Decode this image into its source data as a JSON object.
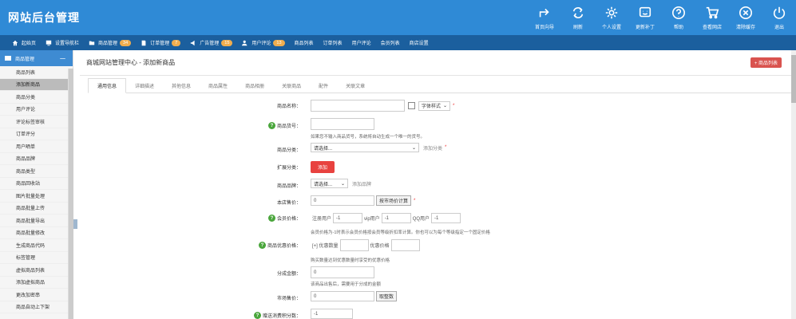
{
  "app": {
    "title": "网站后台管理"
  },
  "tools": [
    {
      "icon": "share-icon",
      "label": "首页向导"
    },
    {
      "icon": "refresh-icon",
      "label": "刷新"
    },
    {
      "icon": "gear-icon",
      "label": "个人设置"
    },
    {
      "icon": "update-icon",
      "label": "更新补丁"
    },
    {
      "icon": "help-icon",
      "label": "帮助"
    },
    {
      "icon": "cart-icon",
      "label": "查看网店"
    },
    {
      "icon": "clear-icon",
      "label": "清除缓存"
    },
    {
      "icon": "power-icon",
      "label": "退出"
    }
  ],
  "nav": [
    {
      "label": "起始页",
      "badge": ""
    },
    {
      "label": "设置导航栏",
      "badge": ""
    },
    {
      "label": "商品管理",
      "badge": "34"
    },
    {
      "label": "订单管理",
      "badge": "7"
    },
    {
      "label": "广告管理",
      "badge": "15"
    },
    {
      "label": "用户评论",
      "badge": "13"
    },
    {
      "label": "商品列表",
      "badge": ""
    },
    {
      "label": "订单列表",
      "badge": ""
    },
    {
      "label": "用户评论",
      "badge": ""
    },
    {
      "label": "会员列表",
      "badge": ""
    },
    {
      "label": "商店设置",
      "badge": ""
    }
  ],
  "sidebar": {
    "head": "商品管理",
    "minus": "－",
    "items": [
      "商品列表",
      "添加新商品",
      "商品分类",
      "用户评论",
      "评论标签审核",
      "订单评分",
      "用户晒单",
      "商品品牌",
      "商品类型",
      "商品回收站",
      "图片批量处理",
      "商品批量上传",
      "商品批量导出",
      "商品批量修改",
      "生成商品代码",
      "标签管理",
      "虚拟商品列表",
      "添加虚拟商品",
      "更改加密串",
      "商品自动上下架"
    ],
    "active": 1
  },
  "main": {
    "breadcrumb": "商城网站管理中心 - 添加新商品",
    "list_button": "+ 商品列表",
    "tabs": [
      "通用信息",
      "详细描述",
      "其他信息",
      "商品属性",
      "商品相册",
      "关联商品",
      "配件",
      "关联文章"
    ]
  },
  "form": {
    "name_label": "商品名称：",
    "font_style": "字体样式",
    "required": "*",
    "sn_label": "商品货号：",
    "sn_hint": "如果您不输入商品货号，系统将自动生成一个唯一的货号。",
    "cat_label": "商品分类：",
    "select_please": "请选择...",
    "add_cat": "添加分类",
    "ext_label": "扩展分类：",
    "add_btn": "添加",
    "brand_label": "商品品牌：",
    "add_brand": "添加品牌",
    "price_label": "本店售价：",
    "price_value": "0",
    "calc_btn": "按市场价计算",
    "member_label": "会员价格：",
    "mem": [
      {
        "name": "注册用户",
        "val": "-1"
      },
      {
        "name": "vip用户",
        "val": "-1"
      },
      {
        "name": "QQ用户",
        "val": "-1"
      }
    ],
    "member_hint": "会员价格为-1时表示会员价格按会员等级折扣率计算。你也可以为每个等级指定一个固定价格",
    "promo_label": "商品优惠价格：",
    "promo_add": "[+] 优惠数量",
    "promo_price": "优惠价格",
    "promo_hint": "购买数量达到优惠数量时享受的优惠价格",
    "share_label": "分成金额：",
    "share_value": "0",
    "share_hint": "该商品出售后，需要用于分成的金额",
    "market_label": "市场售价：",
    "market_value": "0",
    "int_btn": "取整数",
    "points_label": "赠送消费积分数：",
    "points_value": "-1"
  }
}
